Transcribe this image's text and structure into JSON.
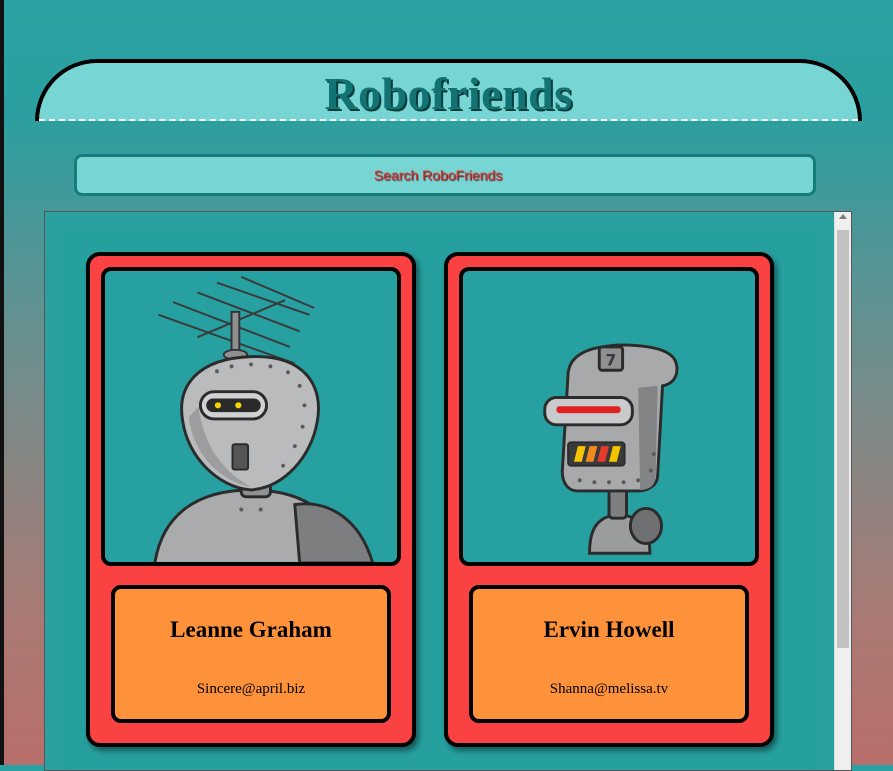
{
  "app": {
    "title": "Robofriends"
  },
  "search": {
    "placeholder": "Search RoboFriends",
    "value": ""
  },
  "colors": {
    "header_bg": "#77d6d4",
    "title_text": "#137272",
    "card_border": "#fa4242",
    "card_info_bg": "#fd923b",
    "image_bg": "#26a0a0"
  },
  "robots": [
    {
      "name": "Leanne Graham",
      "email": "Sincere@april.biz",
      "image_icon": "robot-antenna-icon"
    },
    {
      "name": "Ervin Howell",
      "email": "Shanna@melissa.tv",
      "image_icon": "robot-visor-icon"
    }
  ]
}
